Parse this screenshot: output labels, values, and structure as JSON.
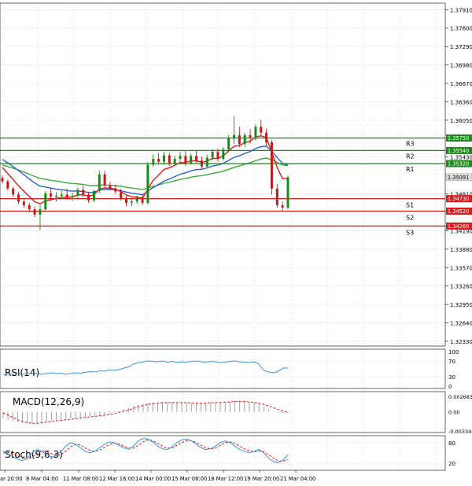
{
  "colors": {
    "background": "#ffffff",
    "grid": "#d8d8d8",
    "bull": "#1a8a1a",
    "bear": "#c41a1a",
    "resistance": "#1a8a1a",
    "support": "#e01a1a",
    "ma_fast": "#e01a1a",
    "ma_mid": "#2a5fd8",
    "ma_slow": "#3aaa3a",
    "price_tag": "#dddddd",
    "rsi": "#3a95d8",
    "macd_signal": "#e01a1a",
    "macd_hist": "#a0a0a0",
    "stoch_main": "#3a95d8",
    "stoch_signal": "#e01a1a"
  },
  "price_axis": {
    "ticks": [
      "1.37910",
      "1.37600",
      "1.37290",
      "1.36980",
      "1.36670",
      "1.36360",
      "1.36050",
      "1.35430",
      "1.34810",
      "1.34190",
      "1.33880",
      "1.33570",
      "1.33260",
      "1.32950",
      "1.32640",
      "1.32330"
    ],
    "current_price": "1.35091"
  },
  "levels": [
    {
      "label": "R3",
      "price": "1.35750",
      "kind": "resistance"
    },
    {
      "label": "R2",
      "price": "1.35540",
      "kind": "resistance"
    },
    {
      "label": "R1",
      "price": "1.35320",
      "kind": "resistance"
    },
    {
      "label": "S1",
      "price": "1.34730",
      "kind": "support"
    },
    {
      "label": "S2",
      "price": "1.34520",
      "kind": "support"
    },
    {
      "label": "S3",
      "price": "1.34269",
      "kind": "support"
    }
  ],
  "time_axis": [
    "ar 20:00",
    "8 Mar 04:00",
    "11 Mar 08:00",
    "12 Mar 16:00",
    "14 Mar 00:00",
    "15 Mar 08:00",
    "18 Mar 12:00",
    "19 Mar 20:00",
    "21 Mar 04:00"
  ],
  "rsi": {
    "title": "RSI(14)",
    "ticks": [
      "100",
      "70",
      "30",
      "0"
    ],
    "values": [
      35,
      37,
      36,
      38,
      36,
      38,
      37,
      39,
      36,
      38,
      40,
      38,
      39,
      36,
      38,
      40,
      39,
      41,
      43,
      42,
      45,
      44,
      47,
      46,
      48,
      52,
      55,
      62,
      66,
      68,
      70,
      69,
      68,
      70,
      67,
      69,
      66,
      68,
      67,
      69,
      70,
      68,
      67,
      69,
      68,
      66,
      67,
      69,
      70,
      68,
      67,
      66,
      68,
      62,
      46,
      42,
      40,
      44,
      52,
      52
    ]
  },
  "macd": {
    "title": "MACD(12,26,9)",
    "ticks": [
      "0.002683",
      "0.00",
      "-0.003346"
    ],
    "histogram": [
      -0.0012,
      -0.0014,
      -0.0016,
      -0.0018,
      -0.0019,
      -0.002,
      -0.002,
      -0.0019,
      -0.0018,
      -0.0017,
      -0.0016,
      -0.0015,
      -0.0014,
      -0.0013,
      -0.0012,
      -0.0011,
      -0.001,
      -0.0009,
      -0.0008,
      -0.0007,
      -0.0006,
      -0.0005,
      -0.0003,
      -0.0001,
      0.0001,
      0.0004,
      0.0007,
      0.001,
      0.0012,
      0.0014,
      0.0015,
      0.0016,
      0.0016,
      0.0017,
      0.0017,
      0.0017,
      0.0016,
      0.0016,
      0.0016,
      0.0015,
      0.0015,
      0.0015,
      0.0016,
      0.0016,
      0.0017,
      0.0017,
      0.0018,
      0.0018,
      0.0019,
      0.0019,
      0.0018,
      0.0017,
      0.0016,
      0.0014,
      0.0009,
      0.0004,
      0.0001,
      -0.0001,
      -0.0002,
      -0.0002
    ],
    "signal": [
      -0.0002,
      -0.0006,
      -0.001,
      -0.0014,
      -0.0017,
      -0.0019,
      -0.002,
      -0.002,
      -0.0019,
      -0.0018,
      -0.0017,
      -0.0016,
      -0.0015,
      -0.0014,
      -0.0013,
      -0.0012,
      -0.0011,
      -0.001,
      -0.0009,
      -0.0008,
      -0.0007,
      -0.0006,
      -0.0005,
      -0.0003,
      -0.0001,
      0.0001,
      0.0003,
      0.0006,
      0.0009,
      0.0011,
      0.0013,
      0.0014,
      0.0015,
      0.0016,
      0.0016,
      0.0016,
      0.0016,
      0.0016,
      0.0016,
      0.0015,
      0.0015,
      0.0015,
      0.0015,
      0.0016,
      0.0016,
      0.0016,
      0.0017,
      0.0017,
      0.0018,
      0.0018,
      0.0018,
      0.0017,
      0.0016,
      0.0015,
      0.0013,
      0.001,
      0.0007,
      0.0004,
      0.0001,
      -0.0001
    ]
  },
  "stoch": {
    "title": "Stoch(9,6,3)",
    "ticks": [
      "80",
      "20"
    ],
    "main": [
      55,
      48,
      40,
      32,
      28,
      35,
      50,
      60,
      55,
      45,
      38,
      42,
      55,
      70,
      80,
      75,
      65,
      55,
      50,
      55,
      65,
      75,
      82,
      80,
      72,
      65,
      60,
      70,
      85,
      92,
      90,
      82,
      70,
      62,
      60,
      68,
      80,
      88,
      90,
      85,
      75,
      65,
      60,
      62,
      70,
      80,
      85,
      80,
      70,
      60,
      55,
      50,
      55,
      60,
      50,
      35,
      25,
      22,
      30,
      45
    ],
    "signal": [
      50,
      52,
      48,
      42,
      36,
      32,
      38,
      48,
      56,
      54,
      48,
      42,
      46,
      56,
      68,
      75,
      73,
      65,
      58,
      54,
      58,
      66,
      74,
      78,
      76,
      70,
      64,
      64,
      72,
      82,
      88,
      86,
      78,
      70,
      64,
      64,
      72,
      80,
      86,
      86,
      80,
      72,
      65,
      62,
      64,
      72,
      80,
      82,
      78,
      70,
      62,
      56,
      54,
      56,
      54,
      45,
      35,
      27,
      26,
      32
    ]
  },
  "chart_data": [
    {
      "type": "candlestick",
      "title": "",
      "x": [
        "ar 20:00",
        "8 Mar 04:00",
        "11 Mar 08:00",
        "12 Mar 16:00",
        "14 Mar 00:00",
        "15 Mar 08:00",
        "18 Mar 12:00",
        "19 Mar 20:00",
        "21 Mar 04:00"
      ],
      "ylim": [
        1.3225,
        1.3802
      ],
      "ohlc": [
        [
          1.3508,
          1.3512,
          1.3499,
          1.3502
        ],
        [
          1.3502,
          1.3505,
          1.3487,
          1.349
        ],
        [
          1.349,
          1.3493,
          1.3476,
          1.348
        ],
        [
          1.348,
          1.3484,
          1.3464,
          1.3468
        ],
        [
          1.3468,
          1.3472,
          1.3458,
          1.3462
        ],
        [
          1.3462,
          1.3466,
          1.345,
          1.3455
        ],
        [
          1.3455,
          1.3459,
          1.3442,
          1.3446
        ],
        [
          1.3446,
          1.3462,
          1.342,
          1.3455
        ],
        [
          1.3455,
          1.3486,
          1.3451,
          1.3482
        ],
        [
          1.3482,
          1.349,
          1.347,
          1.3476
        ],
        [
          1.3476,
          1.3484,
          1.3468,
          1.3478
        ],
        [
          1.3478,
          1.3486,
          1.3472,
          1.348
        ],
        [
          1.348,
          1.349,
          1.3471,
          1.3475
        ],
        [
          1.3475,
          1.3483,
          1.3469,
          1.3478
        ],
        [
          1.3478,
          1.3492,
          1.3474,
          1.3488
        ],
        [
          1.3488,
          1.3495,
          1.3476,
          1.348
        ],
        [
          1.348,
          1.3484,
          1.3466,
          1.347
        ],
        [
          1.347,
          1.3488,
          1.3467,
          1.3486
        ],
        [
          1.3486,
          1.352,
          1.3483,
          1.3514
        ],
        [
          1.3514,
          1.352,
          1.3492,
          1.3495
        ],
        [
          1.3495,
          1.3501,
          1.3487,
          1.349
        ],
        [
          1.349,
          1.3497,
          1.3481,
          1.3485
        ],
        [
          1.3485,
          1.349,
          1.347,
          1.3474
        ],
        [
          1.3474,
          1.3478,
          1.346,
          1.3466
        ],
        [
          1.3466,
          1.3472,
          1.346,
          1.3468
        ],
        [
          1.3468,
          1.3478,
          1.3464,
          1.3475
        ],
        [
          1.3475,
          1.348,
          1.3462,
          1.3466
        ],
        [
          1.3466,
          1.3535,
          1.3463,
          1.353
        ],
        [
          1.353,
          1.3548,
          1.3526,
          1.354
        ],
        [
          1.354,
          1.355,
          1.353,
          1.3535
        ],
        [
          1.3535,
          1.3552,
          1.353,
          1.3546
        ],
        [
          1.3546,
          1.355,
          1.3528,
          1.3532
        ],
        [
          1.3532,
          1.3545,
          1.3529,
          1.354
        ],
        [
          1.354,
          1.3552,
          1.3535,
          1.3545
        ],
        [
          1.3545,
          1.3553,
          1.3528,
          1.3533
        ],
        [
          1.3533,
          1.3549,
          1.353,
          1.3545
        ],
        [
          1.3545,
          1.3554,
          1.3533,
          1.3537
        ],
        [
          1.3537,
          1.3544,
          1.3522,
          1.3527
        ],
        [
          1.3527,
          1.3547,
          1.3524,
          1.3542
        ],
        [
          1.3542,
          1.3556,
          1.3538,
          1.3552
        ],
        [
          1.3552,
          1.3557,
          1.3536,
          1.354
        ],
        [
          1.354,
          1.356,
          1.3537,
          1.3556
        ],
        [
          1.3556,
          1.358,
          1.355,
          1.3575
        ],
        [
          1.3575,
          1.3612,
          1.3565,
          1.358
        ],
        [
          1.358,
          1.3594,
          1.356,
          1.3565
        ],
        [
          1.3565,
          1.3584,
          1.356,
          1.358
        ],
        [
          1.358,
          1.359,
          1.3566,
          1.3576
        ],
        [
          1.3576,
          1.3598,
          1.3571,
          1.3594
        ],
        [
          1.3594,
          1.3606,
          1.3578,
          1.3584
        ],
        [
          1.3584,
          1.359,
          1.3562,
          1.3568
        ],
        [
          1.3568,
          1.3572,
          1.348,
          1.349
        ],
        [
          1.349,
          1.3498,
          1.3458,
          1.3462
        ],
        [
          1.3462,
          1.3468,
          1.3452,
          1.3458
        ],
        [
          1.3458,
          1.3512,
          1.3455,
          1.3509
        ]
      ],
      "levels": {
        "R3": 1.3575,
        "R2": 1.3554,
        "R1": 1.3532,
        "S1": 1.3473,
        "S2": 1.3452,
        "S3": 1.34269
      }
    }
  ]
}
